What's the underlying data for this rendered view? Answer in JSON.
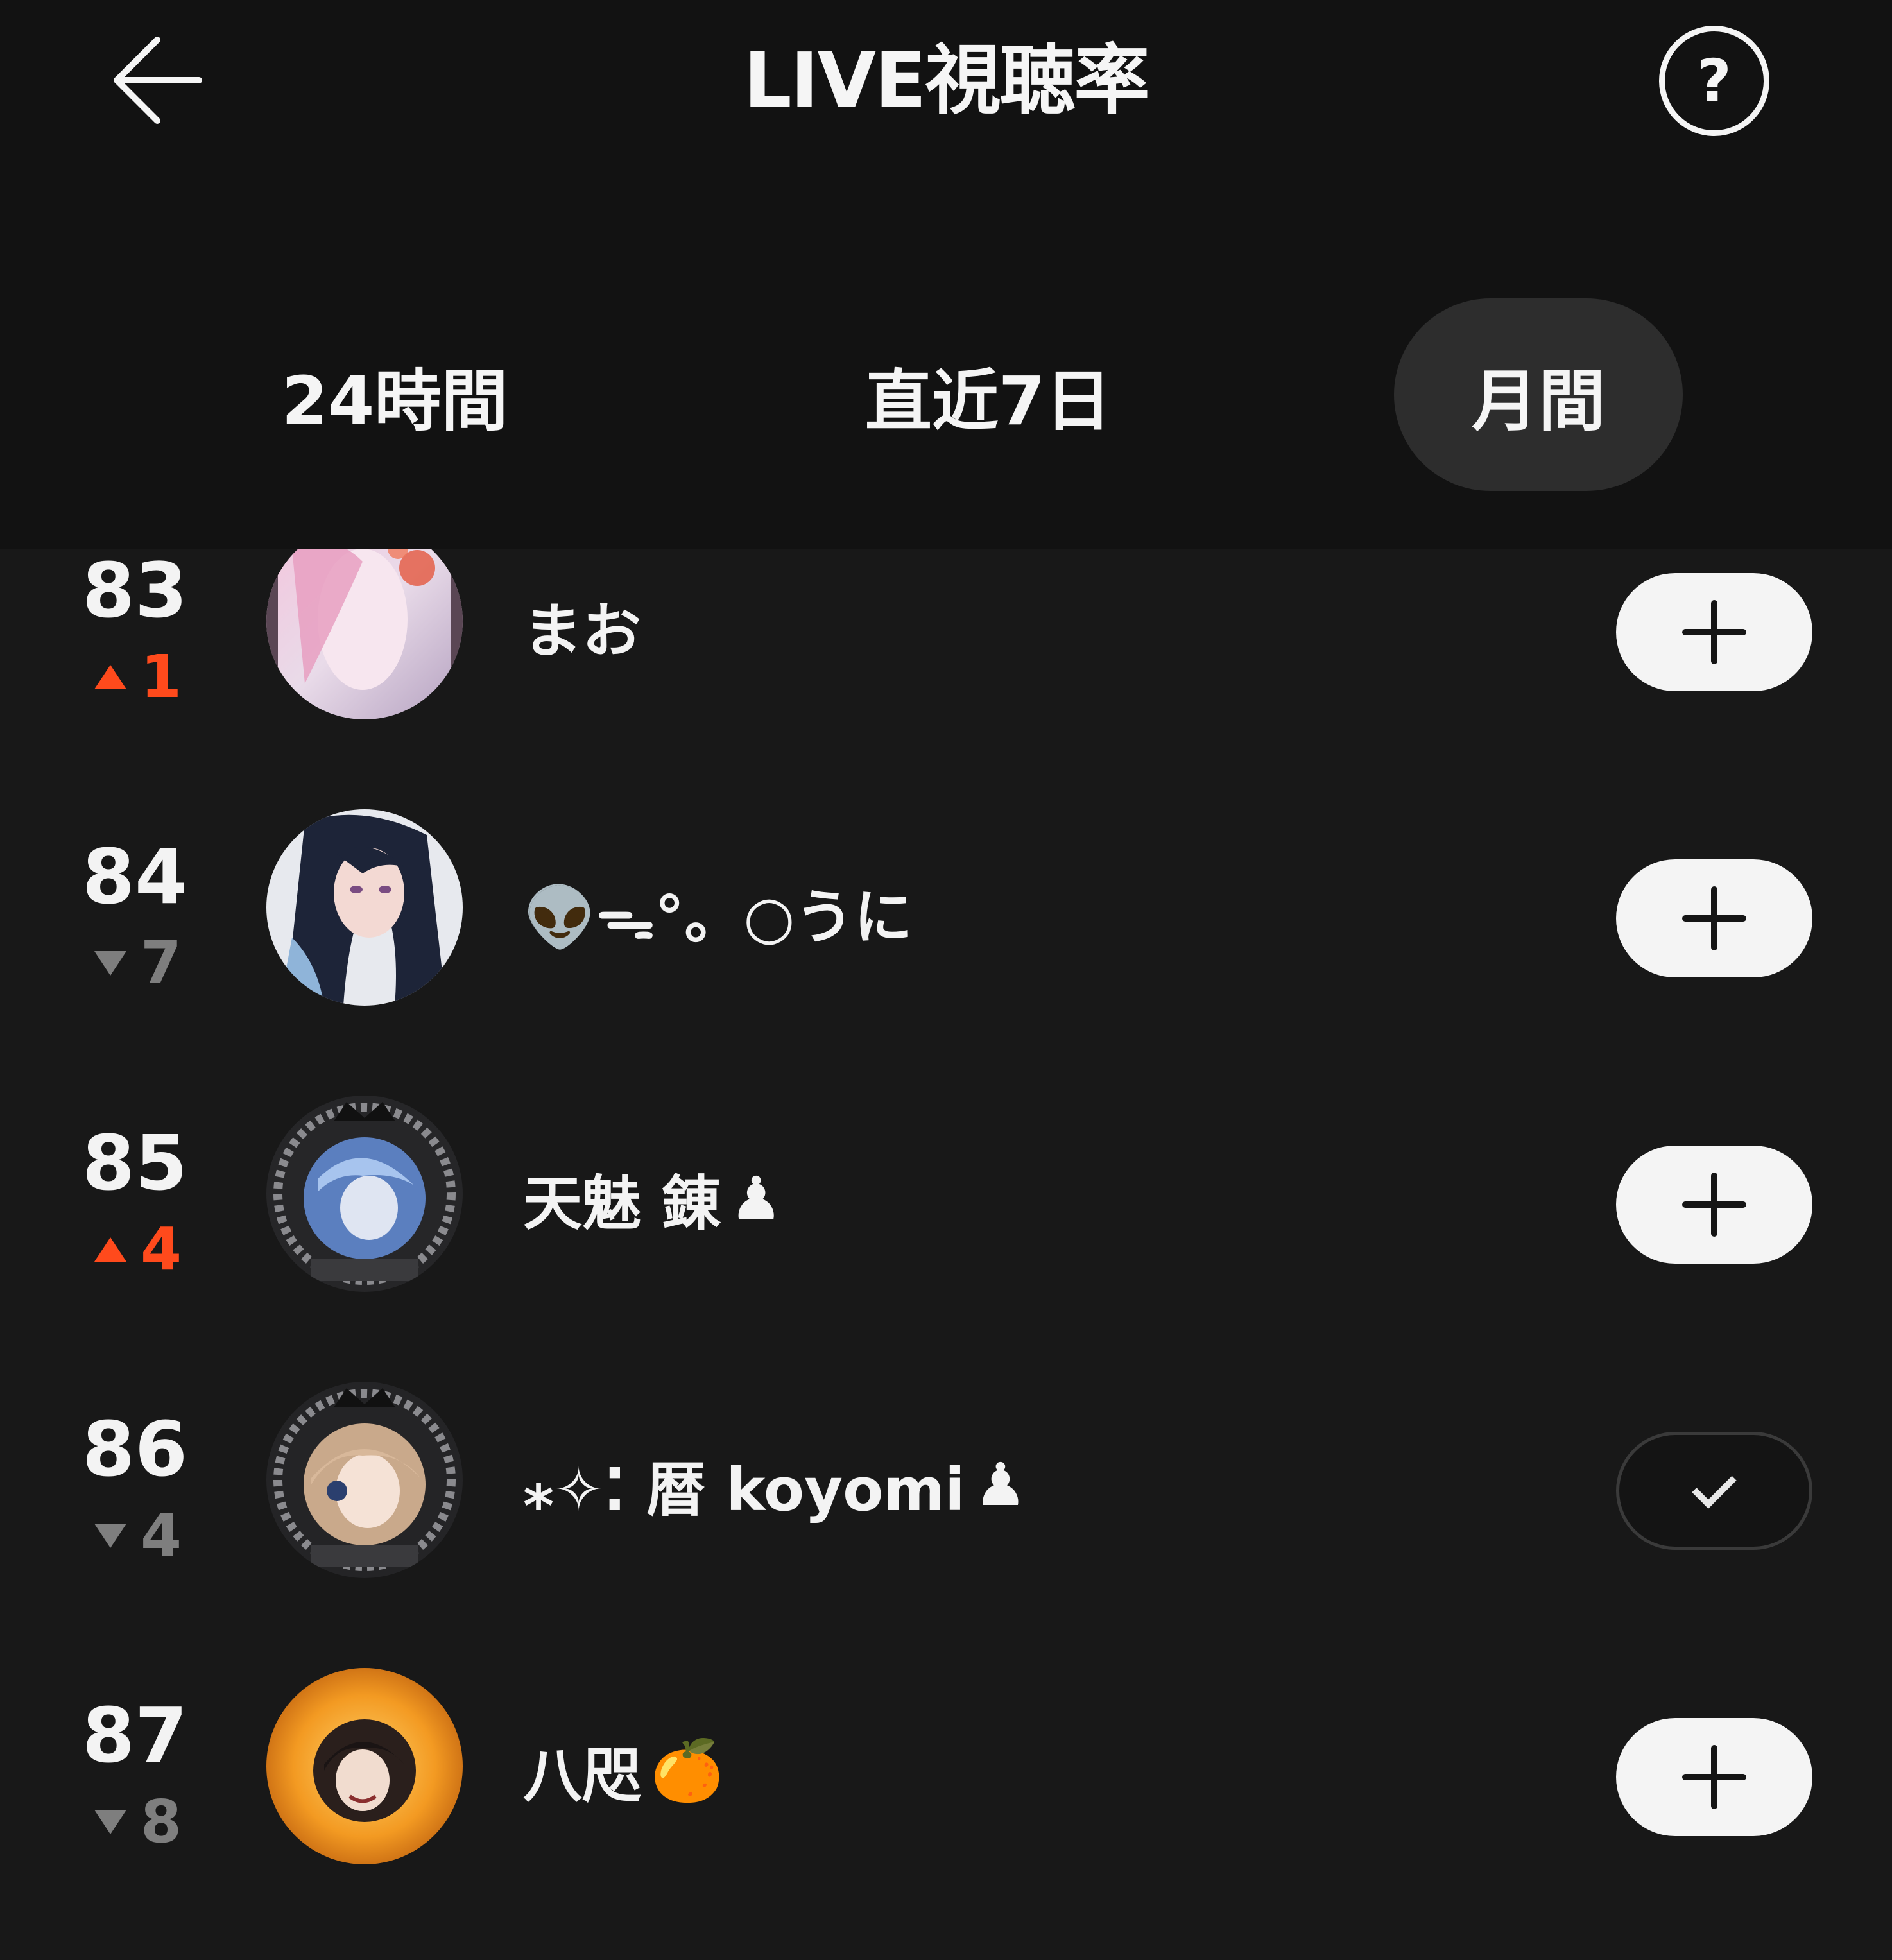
{
  "header": {
    "title": "LIVE視聴率",
    "help_label": "?"
  },
  "tabs": [
    {
      "label": "24時間",
      "active": false
    },
    {
      "label": "直近7日",
      "active": false
    },
    {
      "label": "月間",
      "active": true
    }
  ],
  "icons": {
    "back": "arrow-left-icon",
    "help": "question-circle-icon",
    "follow": "plus-icon",
    "following": "check-icon",
    "rank_up": "triangle-up-icon",
    "rank_down": "triangle-down-icon"
  },
  "colors": {
    "background": "#181818",
    "header_background": "#121212",
    "active_tab_pill": "#2d2d2d",
    "rank_up": "#ff4a1c",
    "rank_down": "#7e7e7e",
    "follow_button": "#f4f4f4"
  },
  "rankings": [
    {
      "rank": "83",
      "direction": "up",
      "change": "1",
      "name": "まお",
      "emoji": "",
      "following": false
    },
    {
      "rank": "84",
      "direction": "down",
      "change": "7",
      "name": "👽ᯓ°。○うに",
      "emoji": "",
      "following": false
    },
    {
      "rank": "85",
      "direction": "up",
      "change": "4",
      "name": "天魅 錬",
      "emoji": "♟",
      "following": false
    },
    {
      "rank": "86",
      "direction": "down",
      "change": "4",
      "name": "⁎✧⁚ 暦 koyomi",
      "emoji": "♟",
      "following": true
    },
    {
      "rank": "87",
      "direction": "down",
      "change": "8",
      "name": "八咫",
      "emoji": "🍊",
      "following": false
    }
  ]
}
